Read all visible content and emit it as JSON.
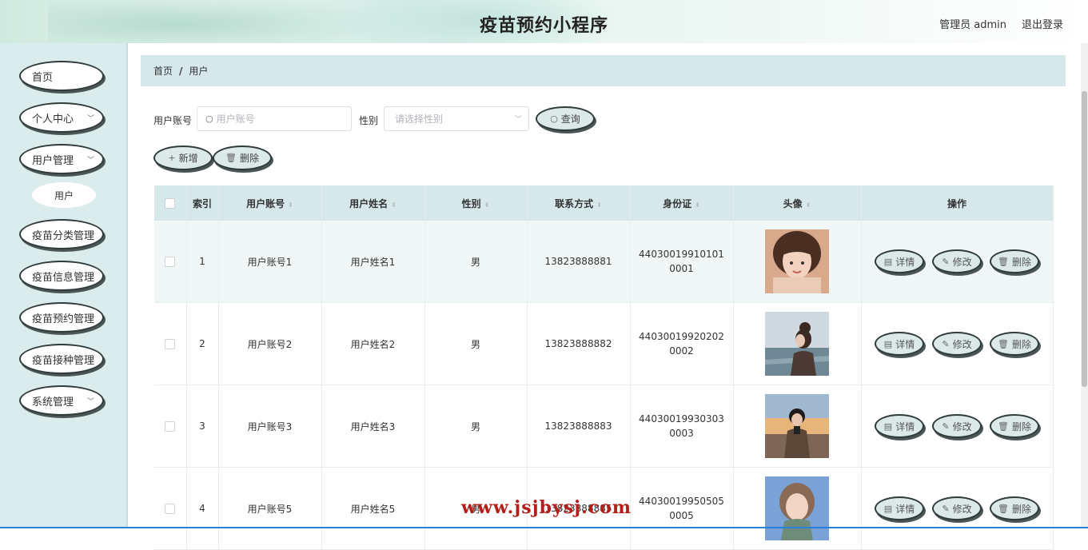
{
  "header": {
    "title": "疫苗预约小程序",
    "admin_label": "管理员 admin",
    "logout_label": "退出登录"
  },
  "sidebar": {
    "items": [
      {
        "label": "首页",
        "has_children": false
      },
      {
        "label": "个人中心",
        "has_children": true
      },
      {
        "label": "用户管理",
        "has_children": true
      },
      {
        "label": "疫苗分类管理",
        "has_children": false
      },
      {
        "label": "疫苗信息管理",
        "has_children": false
      },
      {
        "label": "疫苗预约管理",
        "has_children": false
      },
      {
        "label": "疫苗接种管理",
        "has_children": false
      },
      {
        "label": "系统管理",
        "has_children": true
      }
    ],
    "sub_item": "用户"
  },
  "breadcrumb": {
    "home": "首页",
    "separator": "/",
    "current": "用户"
  },
  "search": {
    "account_label": "用户账号",
    "account_placeholder": "用户账号",
    "gender_label": "性别",
    "gender_placeholder": "请选择性别",
    "query_button": "查询"
  },
  "actions": {
    "add_button": "新增",
    "delete_button": "删除"
  },
  "table": {
    "columns": [
      "索引",
      "用户账号",
      "用户姓名",
      "性别",
      "联系方式",
      "身份证",
      "头像",
      "操作"
    ],
    "rows": [
      {
        "index": "1",
        "account": "用户账号1",
        "name": "用户姓名1",
        "gender": "男",
        "phone": "13823888881",
        "id_card": "440300199101010001",
        "avatar": "avatar-girl-smiling"
      },
      {
        "index": "2",
        "account": "用户账号2",
        "name": "用户姓名2",
        "gender": "男",
        "phone": "13823888882",
        "id_card": "440300199202020002",
        "avatar": "avatar-girl-seaside"
      },
      {
        "index": "3",
        "account": "用户账号3",
        "name": "用户姓名3",
        "gender": "男",
        "phone": "13823888883",
        "id_card": "440300199303030003",
        "avatar": "avatar-boy-sunset"
      },
      {
        "index": "4",
        "account": "用户账号5",
        "name": "用户姓名5",
        "gender": "男",
        "phone": "13823888885",
        "id_card": "440300199505050005",
        "avatar": "avatar-girl-sky"
      }
    ],
    "row_actions": {
      "detail": "详情",
      "edit": "修改",
      "delete": "删除"
    }
  },
  "watermark": "www.jsjbysj.com",
  "colors": {
    "sidebar_bg": "#dbecec",
    "header_row_bg": "#d6e8ea",
    "button_bg": "#dbe9e9",
    "watermark": "#b3201b"
  }
}
